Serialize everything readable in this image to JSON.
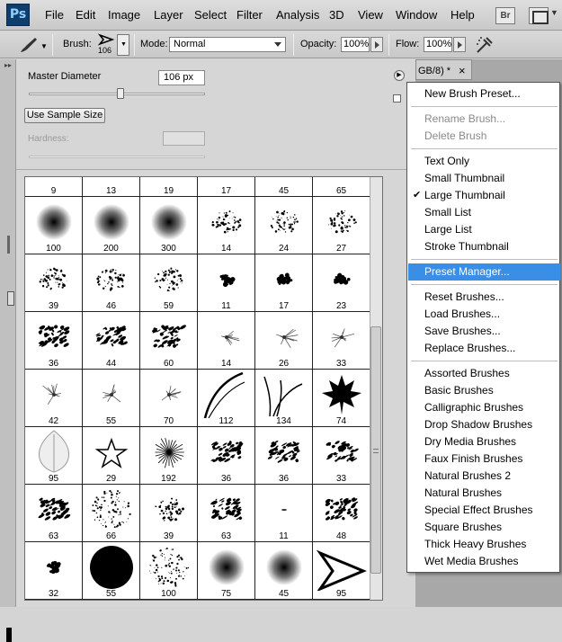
{
  "app": {
    "logo": "Ps"
  },
  "menubar": {
    "items": [
      "File",
      "Edit",
      "Image",
      "Layer",
      "Select",
      "Filter",
      "Analysis",
      "3D",
      "View",
      "Window",
      "Help"
    ],
    "bridge_label": "Br"
  },
  "options": {
    "brush_label": "Brush:",
    "brush_size": "106",
    "mode_label": "Mode:",
    "mode_value": "Normal",
    "opacity_label": "Opacity:",
    "opacity_value": "100%",
    "flow_label": "Flow:",
    "flow_value": "100%"
  },
  "panel": {
    "master_diameter_label": "Master Diameter",
    "master_diameter_value": "106 px",
    "master_diameter_fraction": 0.52,
    "use_sample_size": "Use Sample Size",
    "hardness_label": "Hardness:"
  },
  "document_tab": {
    "title": "GB/8) *",
    "close": "×"
  },
  "brushes": {
    "top_row": [
      "9",
      "13",
      "19",
      "17",
      "45",
      "65"
    ],
    "rows": [
      [
        {
          "n": "100",
          "t": "soft"
        },
        {
          "n": "200",
          "t": "soft"
        },
        {
          "n": "300",
          "t": "soft"
        },
        {
          "n": "14",
          "t": "spatter"
        },
        {
          "n": "24",
          "t": "spatter"
        },
        {
          "n": "27",
          "t": "spatter"
        }
      ],
      [
        {
          "n": "39",
          "t": "spatter"
        },
        {
          "n": "46",
          "t": "spatter"
        },
        {
          "n": "59",
          "t": "spatter"
        },
        {
          "n": "11",
          "t": "blob"
        },
        {
          "n": "17",
          "t": "blob"
        },
        {
          "n": "23",
          "t": "blob"
        }
      ],
      [
        {
          "n": "36",
          "t": "chalk"
        },
        {
          "n": "44",
          "t": "chalk"
        },
        {
          "n": "60",
          "t": "chalk"
        },
        {
          "n": "14",
          "t": "star"
        },
        {
          "n": "26",
          "t": "star"
        },
        {
          "n": "33",
          "t": "star"
        }
      ],
      [
        {
          "n": "42",
          "t": "star"
        },
        {
          "n": "55",
          "t": "star"
        },
        {
          "n": "70",
          "t": "star"
        },
        {
          "n": "112",
          "t": "grass1"
        },
        {
          "n": "134",
          "t": "grass2"
        },
        {
          "n": "74",
          "t": "leaf"
        }
      ],
      [
        {
          "n": "95",
          "t": "leafskel"
        },
        {
          "n": "29",
          "t": "staroutline"
        },
        {
          "n": "192",
          "t": "burst"
        },
        {
          "n": "36",
          "t": "chalk"
        },
        {
          "n": "36",
          "t": "chalk"
        },
        {
          "n": "33",
          "t": "chalk"
        }
      ],
      [
        {
          "n": "63",
          "t": "chalk"
        },
        {
          "n": "66",
          "t": "dots"
        },
        {
          "n": "39",
          "t": "spatter"
        },
        {
          "n": "63",
          "t": "chalk"
        },
        {
          "n": "11",
          "t": "tiny"
        },
        {
          "n": "48",
          "t": "chalk"
        }
      ],
      [
        {
          "n": "32",
          "t": "blob"
        },
        {
          "n": "55",
          "t": "hard"
        },
        {
          "n": "100",
          "t": "dots"
        },
        {
          "n": "75",
          "t": "soft"
        },
        {
          "n": "45",
          "t": "soft"
        },
        {
          "n": "95",
          "t": "arrow"
        }
      ]
    ]
  },
  "flyout": {
    "groups": [
      [
        {
          "label": "New Brush Preset...",
          "state": "normal"
        }
      ],
      [
        {
          "label": "Rename Brush...",
          "state": "disabled"
        },
        {
          "label": "Delete Brush",
          "state": "disabled"
        }
      ],
      [
        {
          "label": "Text Only",
          "state": "normal"
        },
        {
          "label": "Small Thumbnail",
          "state": "normal"
        },
        {
          "label": "Large Thumbnail",
          "state": "checked"
        },
        {
          "label": "Small List",
          "state": "normal"
        },
        {
          "label": "Large List",
          "state": "normal"
        },
        {
          "label": "Stroke Thumbnail",
          "state": "normal"
        }
      ],
      [
        {
          "label": "Preset Manager...",
          "state": "highlighted"
        }
      ],
      [
        {
          "label": "Reset Brushes...",
          "state": "normal"
        },
        {
          "label": "Load Brushes...",
          "state": "normal"
        },
        {
          "label": "Save Brushes...",
          "state": "normal"
        },
        {
          "label": "Replace Brushes...",
          "state": "normal"
        }
      ],
      [
        {
          "label": "Assorted Brushes",
          "state": "normal"
        },
        {
          "label": "Basic Brushes",
          "state": "normal"
        },
        {
          "label": "Calligraphic Brushes",
          "state": "normal"
        },
        {
          "label": "Drop Shadow Brushes",
          "state": "normal"
        },
        {
          "label": "Dry Media Brushes",
          "state": "normal"
        },
        {
          "label": "Faux Finish Brushes",
          "state": "normal"
        },
        {
          "label": "Natural Brushes 2",
          "state": "normal"
        },
        {
          "label": "Natural Brushes",
          "state": "normal"
        },
        {
          "label": "Special Effect Brushes",
          "state": "normal"
        },
        {
          "label": "Square Brushes",
          "state": "normal"
        },
        {
          "label": "Thick Heavy Brushes",
          "state": "normal"
        },
        {
          "label": "Wet Media Brushes",
          "state": "normal"
        }
      ]
    ]
  },
  "colors": {
    "highlight": "#3a8ee6",
    "app_blue": "#0f3d6e"
  }
}
